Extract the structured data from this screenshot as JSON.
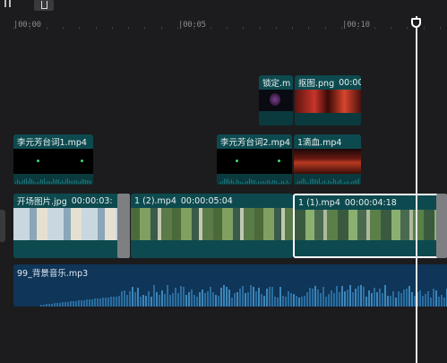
{
  "toolbar": {
    "split_icon": "split-icon",
    "delete_icon": "delete-icon"
  },
  "ruler": {
    "labels": [
      "|00:00",
      "|00:05",
      "|00:10"
    ]
  },
  "clips": {
    "lock": {
      "name": "锁定.m",
      "time": ""
    },
    "cutout": {
      "name": "抠图.png",
      "time": "00:00"
    },
    "lyric1": {
      "name": "李元芳台词1.mp4",
      "time": ""
    },
    "lyric2": {
      "name": "李元芳台词2.mp4",
      "time": ""
    },
    "firstblood": {
      "name": "1滴血.mp4",
      "time": ""
    },
    "opening": {
      "name": "开场图片.jpg",
      "time": "00:00:03:"
    },
    "clip1_2": {
      "name": "1 (2).mp4",
      "time": "00:00:05:04"
    },
    "clip1_1": {
      "name": "1 (1).mp4",
      "time": "00:00:04:18"
    }
  },
  "audio": {
    "name": "99_背景音乐.mp3"
  },
  "colors": {
    "video_clip": "#0d4a4f",
    "audio_track": "#0f3558",
    "playhead": "#e8e8e8",
    "background": "#1c1c1e"
  }
}
